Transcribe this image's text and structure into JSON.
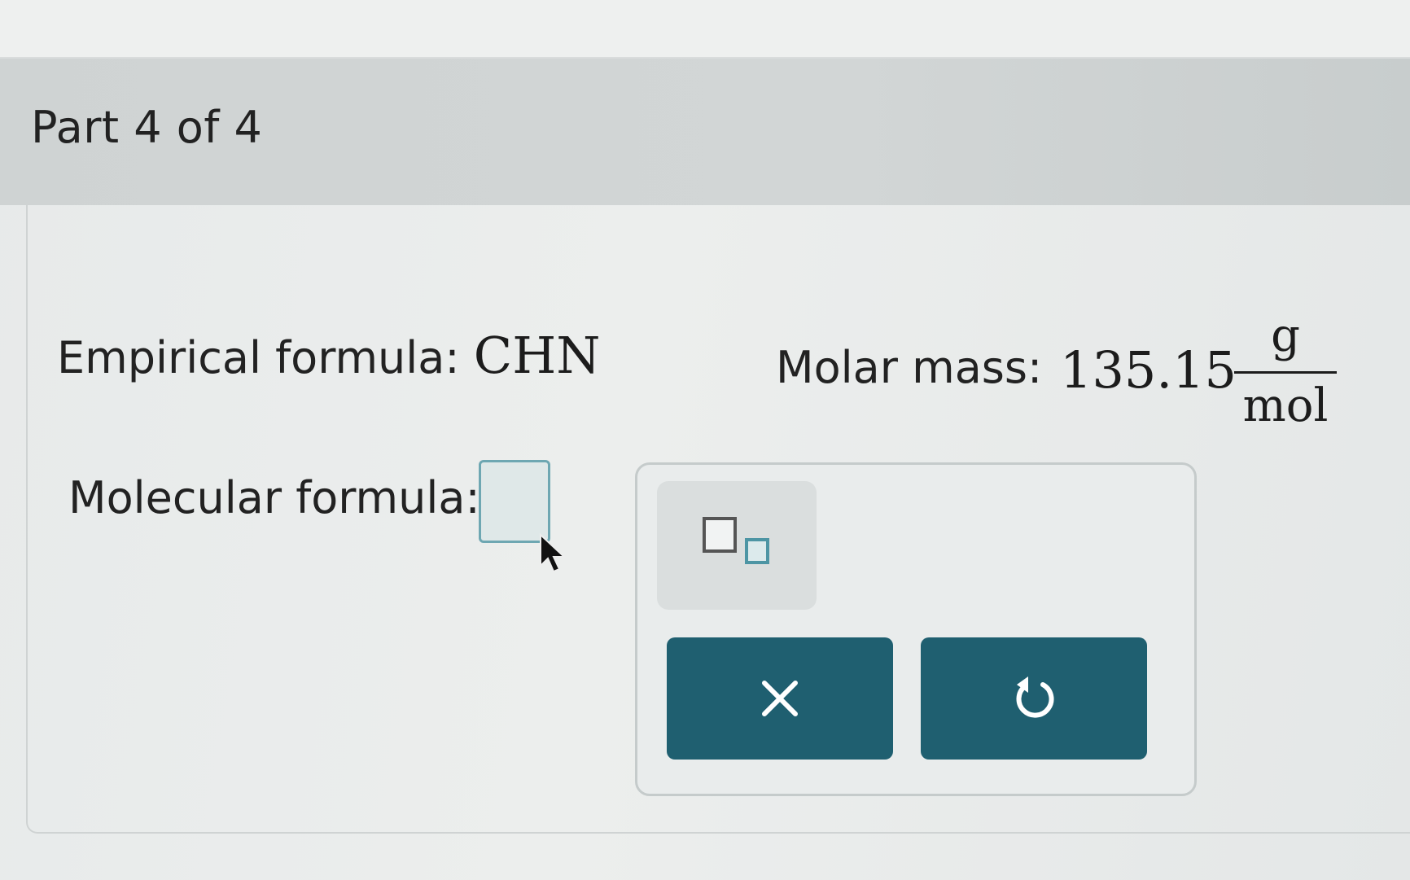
{
  "part": {
    "title": "Part 4 of 4"
  },
  "question": {
    "empirical_label": "Empirical formula:",
    "empirical_value": "CHN",
    "molar_mass_label": "Molar mass:",
    "molar_mass_value": "135.15",
    "molar_mass_unit_numerator": "g",
    "molar_mass_unit_denominator": "mol",
    "molecular_label": "Molecular formula:"
  },
  "answer": {
    "value": ""
  },
  "palette": {
    "tools": [
      {
        "icon": "subscript-icon"
      }
    ],
    "buttons": [
      {
        "icon": "close-icon",
        "color": "#1f5f70"
      },
      {
        "icon": "undo-icon",
        "color": "#1f5f70"
      }
    ]
  },
  "colors": {
    "header_bg": "#cfd3d3",
    "button_bg": "#1f5f70",
    "input_border": "#6ea7b2"
  }
}
